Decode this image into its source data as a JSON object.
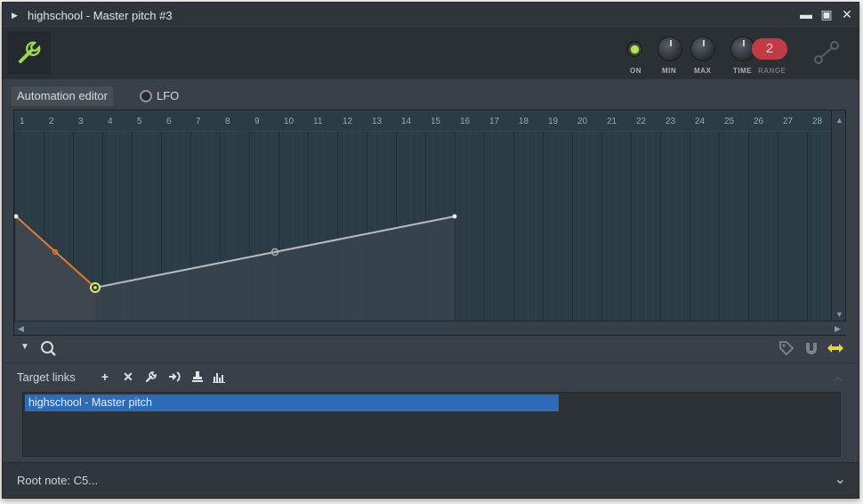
{
  "window": {
    "title": "highschool - Master pitch #3",
    "controls": {
      "minimize": "▬",
      "maximize": "▣",
      "close": "✕"
    }
  },
  "toolbar": {
    "knobs": {
      "on": "ON",
      "min": "MIN",
      "max": "MAX",
      "time": "TIME",
      "range": "RANGE"
    },
    "range_value": "2",
    "led_color": "#b9e25a",
    "accent_red": "#c33a47"
  },
  "tabs": {
    "automation_editor": "Automation editor",
    "lfo": "LFO"
  },
  "ruler": [
    "1",
    "2",
    "3",
    "4",
    "5",
    "6",
    "7",
    "8",
    "9",
    "10",
    "11",
    "12",
    "13",
    "14",
    "15",
    "16",
    "17",
    "18",
    "19",
    "20",
    "21",
    "22",
    "23",
    "24",
    "25",
    "26",
    "27",
    "28"
  ],
  "automation": {
    "curve_color": "#b7bcc6",
    "active_color": "#e07a32"
  },
  "editor_footer": {
    "icons": [
      "chevron-down-icon",
      "zoom-icon",
      "tag-icon",
      "magnet-icon",
      "horizontal-arrows-icon"
    ]
  },
  "target_links": {
    "label": "Target links",
    "icons": [
      "plus-icon",
      "close-icon",
      "wrench-icon",
      "link-icon",
      "stamp-icon",
      "bars-icon"
    ],
    "items": [
      "highschool - Master pitch"
    ]
  },
  "root_note": {
    "label": "Root note: C5..."
  }
}
